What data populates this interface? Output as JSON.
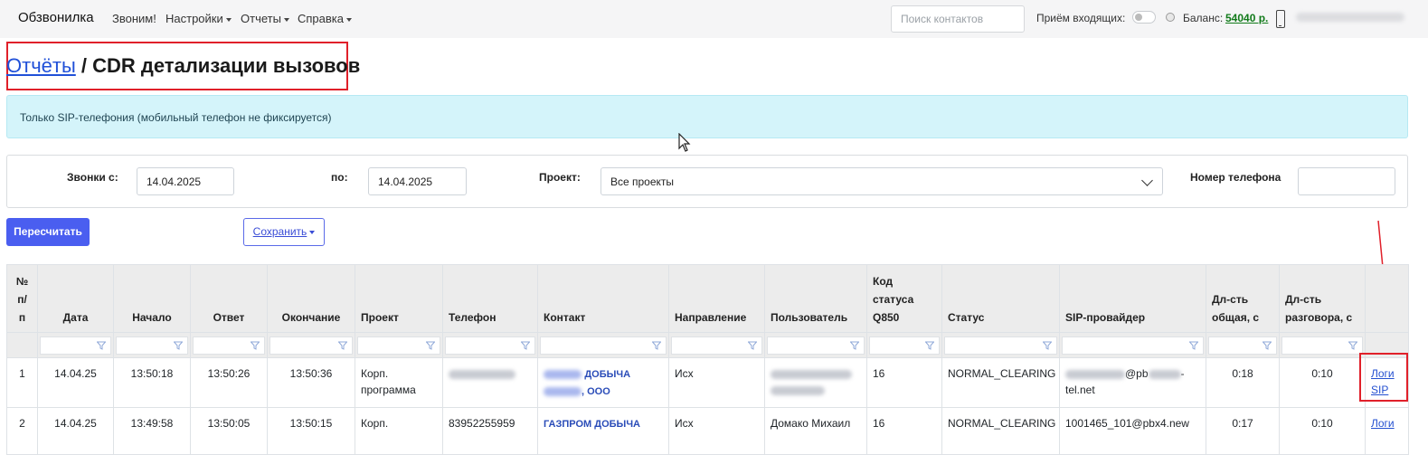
{
  "navbar": {
    "brand": "Обзвонилка",
    "items": [
      "Звоним!",
      "Настройки",
      "Отчеты",
      "Справка"
    ],
    "search_placeholder": "Поиск контактов",
    "incoming_label": "Приём входящих:",
    "balance_label": "Баланс:",
    "balance_value": "54040 р."
  },
  "title": {
    "crumb": "Отчёты",
    "separator": " / ",
    "current": "CDR детализации вызовов"
  },
  "alert": "Только SIP-телефония (мобильный телефон не фиксируется)",
  "filters": {
    "from_label": "Звонки с:",
    "from_value": "14.04.2025",
    "to_label": "по:",
    "to_value": "14.04.2025",
    "project_label": "Проект:",
    "project_value": "Все проекты",
    "phone_label": "Номер телефона"
  },
  "buttons": {
    "recalc": "Пересчитать",
    "save": "Сохранить"
  },
  "table": {
    "headers": {
      "num": [
        "№",
        "п/",
        "п"
      ],
      "date": "Дата",
      "start": "Начало",
      "answer": "Ответ",
      "end": "Окончание",
      "project": "Проект",
      "phone": "Телефон",
      "contact": "Контакт",
      "direction": "Направление",
      "user": "Пользователь",
      "q850": "Код статуса Q850",
      "status": "Статус",
      "sip": "SIP-провайдер",
      "dur_total": "Дл-сть общая, с",
      "dur_talk": "Дл-сть разговора, с"
    },
    "rows": [
      {
        "num": "1",
        "date": "14.04.25",
        "start": "13:50:18",
        "answer": "13:50:26",
        "end": "13:50:36",
        "project": "Корп. программа",
        "contact_part1": "ДОБЫЧА",
        "contact_part2": ", ООО",
        "direction": "Исх",
        "q850": "16",
        "status": "NORMAL_CLEARING",
        "sip_part1": "@pb",
        "sip_part2": "-",
        "sip_part3": "tel.net",
        "dur_total": "0:18",
        "dur_talk": "0:10",
        "logs": "Логи SIP"
      },
      {
        "num": "2",
        "date": "14.04.25",
        "start": "13:49:58",
        "answer": "13:50:05",
        "end": "13:50:15",
        "project": "Корп.",
        "phone": "83952255959",
        "contact": "ГАЗПРОМ ДОБЫЧА",
        "direction": "Исх",
        "user": "Домако Михаил",
        "q850": "16",
        "status": "NORMAL_CLEARING",
        "sip": "1001465_101@pbx4.new",
        "dur_total": "0:17",
        "dur_talk": "0:10",
        "logs": "Логи"
      }
    ]
  }
}
